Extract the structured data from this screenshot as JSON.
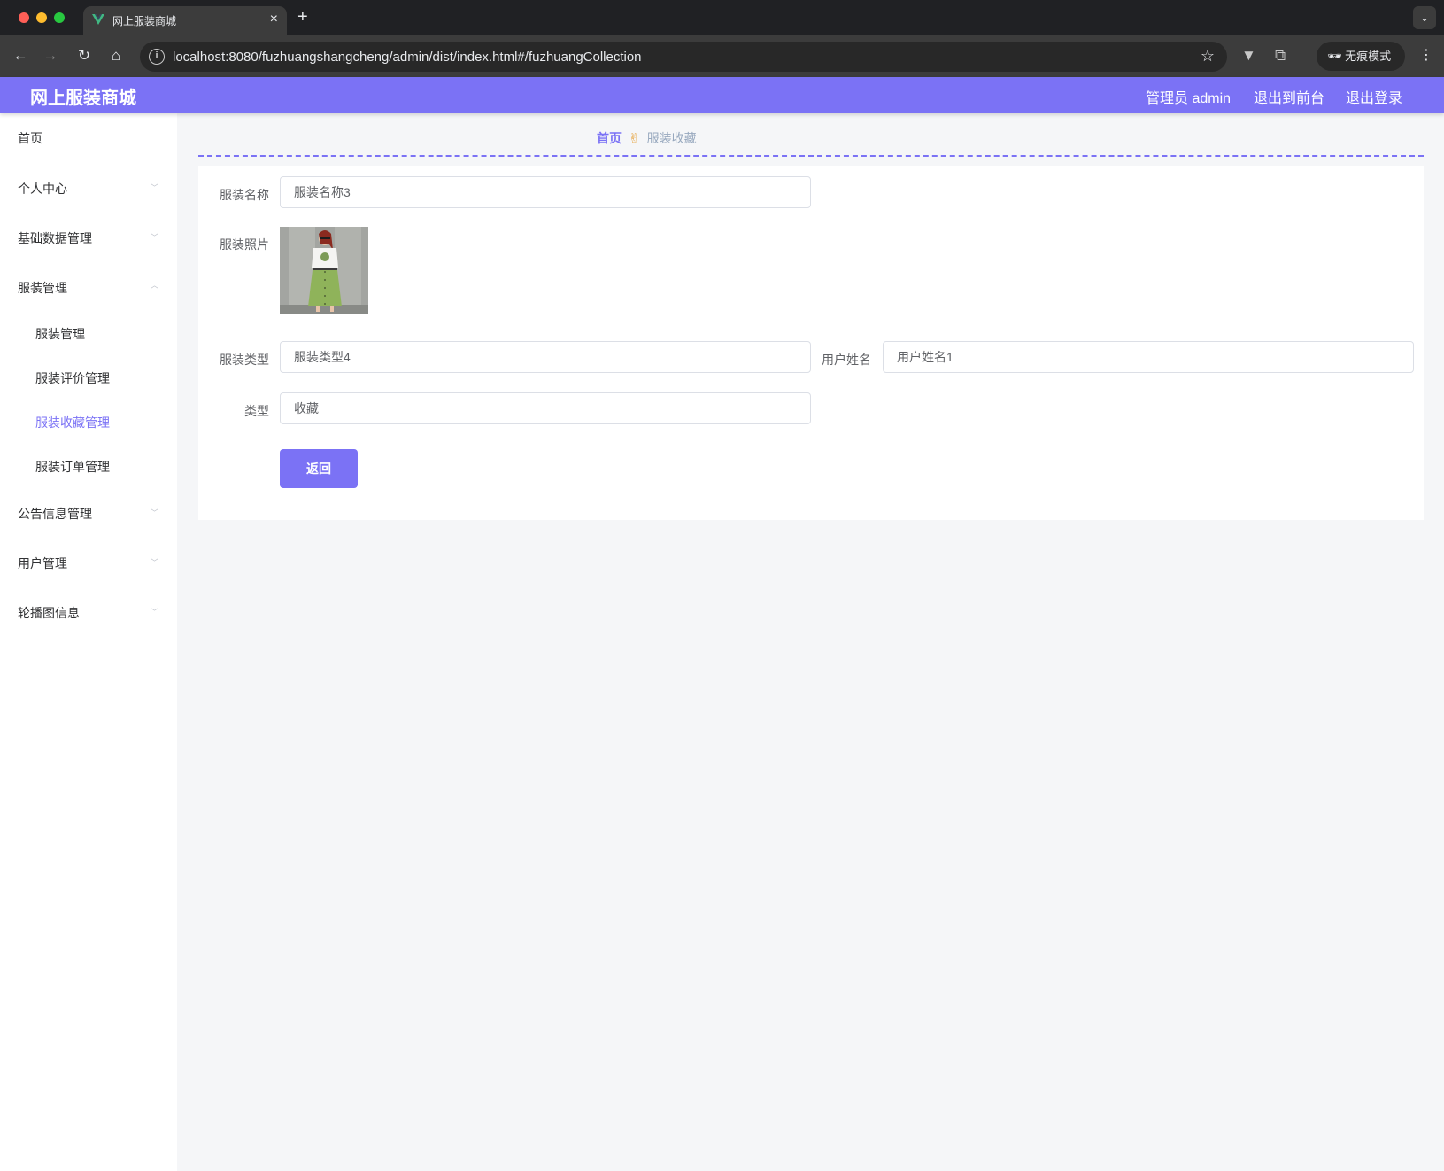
{
  "browser": {
    "tab_title": "网上服装商城",
    "tab_close": "×",
    "new_tab": "+",
    "tab_menu": "⌄",
    "url": "localhost:8080/fuzhuangshangcheng/admin/dist/index.html#/fuzhuangCollection",
    "incognito_label": "无痕模式",
    "icons": [
      "back-icon",
      "forward-icon",
      "reload-icon",
      "home-icon",
      "info-icon",
      "star-icon",
      "vue-devtools-icon",
      "extensions-icon",
      "incognito-icon",
      "more-icon"
    ]
  },
  "header": {
    "title": "网上服装商城",
    "user": "管理员 admin",
    "to_front": "退出到前台",
    "logout": "退出登录",
    "bg_color": "#7b72f5"
  },
  "sidebar": {
    "home": "首页",
    "personal": "个人中心",
    "basic_data": "基础数据管理",
    "clothing": "服装管理",
    "sub": {
      "clothing_mgmt": "服装管理",
      "review_mgmt": "服装评价管理",
      "collection_mgmt": "服装收藏管理",
      "order_mgmt": "服装订单管理"
    },
    "notice": "公告信息管理",
    "users": "用户管理",
    "carousel": "轮播图信息",
    "active_color": "#7b72f5"
  },
  "breadcrumb": {
    "home": "首页",
    "separator": "✌",
    "current": "服装收藏"
  },
  "form": {
    "name_label": "服装名称",
    "name_value": "服装名称3",
    "photo_label": "服装照片",
    "type_label": "服装类型",
    "type_value": "服装类型4",
    "username_label": "用户姓名",
    "username_value": "用户姓名1",
    "kind_label": "类型",
    "kind_value": "收藏",
    "back_button": "返回"
  }
}
